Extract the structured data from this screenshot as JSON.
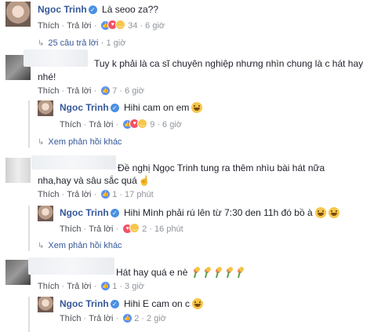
{
  "post": {
    "author": "Ngoc Trinh",
    "text": "Là seoo za??",
    "actions": {
      "like": "Thích",
      "reply": "Trả lời"
    },
    "reaction_count": "34",
    "time": "6 giờ"
  },
  "replies_link": {
    "text": "25 câu trả lời",
    "time": "1 giờ"
  },
  "c1": {
    "text_line1": "Tuy k phải là ca sĩ chuyên nghiệp nhưng nhìn chung là c hát hay",
    "text_line2": "nhé!",
    "actions": {
      "like": "Thích",
      "reply": "Trả lời"
    },
    "reaction_count": "7",
    "time": "6 giờ",
    "reply": {
      "author": "Ngoc Trinh",
      "text": "Hihi cam on em",
      "actions": {
        "like": "Thích",
        "reply": "Trả lời"
      },
      "reaction_count": "9",
      "time": "6 giờ"
    },
    "more": "Xem phản hồi khác"
  },
  "c2": {
    "text_line1": "Đề nghị Ngọc Trinh tung ra thêm nhìu bài hát nữa",
    "text_line2": "nha,hay và sâu sắc quá",
    "actions": {
      "like": "Thích",
      "reply": "Trả lời"
    },
    "reaction_count": "1",
    "time": "17 phút",
    "reply": {
      "author": "Ngoc Trinh",
      "text": "Hihi Mình phải rú lên từ 7:30 den 11h đó bồ à",
      "actions": {
        "like": "Thích",
        "reply": "Trả lời"
      },
      "reaction_count": "2",
      "time": "16 phút"
    },
    "more": "Xem phản hồi khác"
  },
  "c3": {
    "text": "Hát hay quá e nè",
    "actions": {
      "like": "Thích",
      "reply": "Trả lời"
    },
    "reaction_count": "1",
    "time": "3 giờ",
    "reply": {
      "author": "Ngoc Trinh",
      "text": "Hihi E cam on c",
      "actions": {
        "like": "Thích",
        "reply": "Trả lời"
      },
      "reaction_count": "2",
      "time": "2 giờ"
    }
  },
  "icons": {
    "verified": "verified-badge-icon",
    "like": "like-reaction-icon",
    "love": "love-reaction-icon",
    "haha": "haha-reaction-icon",
    "reply_arrow": "reply-arrow-icon"
  },
  "colors": {
    "name": "#365899",
    "meta": "#90949c",
    "like": "#5890ff",
    "love": "#f25268",
    "haha": "#f7c64b"
  }
}
